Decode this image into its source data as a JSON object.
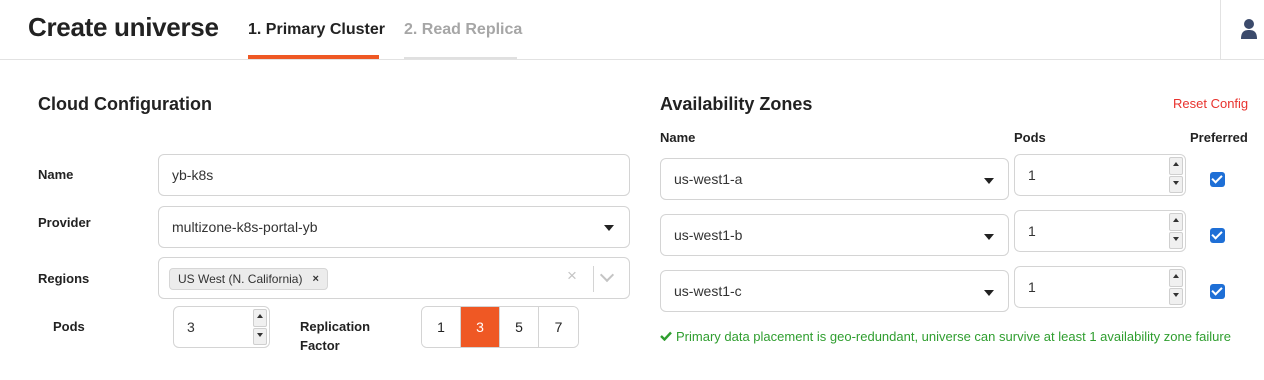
{
  "header": {
    "title": "Create universe",
    "tabs": [
      {
        "label": "1. Primary Cluster",
        "active": true
      },
      {
        "label": "2. Read Replica",
        "active": false
      }
    ],
    "user_icon": "user-icon"
  },
  "cloud_config": {
    "title": "Cloud Configuration",
    "name_label": "Name",
    "name_value": "yb-k8s",
    "provider_label": "Provider",
    "provider_value": "multizone-k8s-portal-yb",
    "regions_label": "Regions",
    "regions_selected": [
      "US West (N. California)"
    ],
    "tag_remove": "×",
    "clear": "×",
    "pods_label": "Pods",
    "pods_value": "3",
    "rf_label_line1": "Replication",
    "rf_label_line2": "Factor",
    "rf_options": [
      "1",
      "3",
      "5",
      "7"
    ],
    "rf_selected": "3"
  },
  "availability_zones": {
    "title": "Availability Zones",
    "reset_label": "Reset Config",
    "columns": [
      "Name",
      "Pods",
      "Preferred"
    ],
    "rows": [
      {
        "zone": "us-west1-a",
        "pods": "1",
        "preferred": true
      },
      {
        "zone": "us-west1-b",
        "pods": "1",
        "preferred": true
      },
      {
        "zone": "us-west1-c",
        "pods": "1",
        "preferred": true
      }
    ],
    "status_icon": "check-icon",
    "status_message": "Primary data placement is geo-redundant, universe can survive at least 1 availability zone failure"
  },
  "colors": {
    "accent": "#ef5824",
    "link_red": "#e8322d",
    "success_green": "#2f9e2f",
    "checkbox_blue": "#1e6fd6",
    "user_icon": "#3b4a6b"
  }
}
